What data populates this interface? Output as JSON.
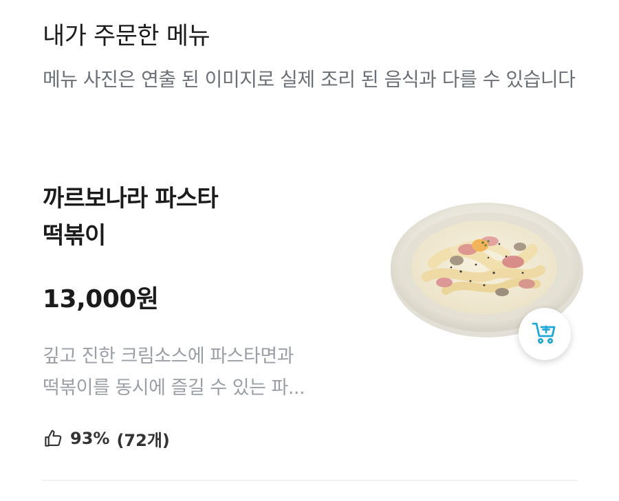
{
  "section": {
    "title": "내가 주문한 메뉴",
    "notice": "메뉴 사진은 연출 된 이미지로 실제 조리 된 음식과 다를 수 있습니다"
  },
  "menu_item": {
    "name_line1": "까르보나라 파스타",
    "name_line2": "떡볶이",
    "price": "13,000원",
    "description_line1": "깊고 진한 크림소스에 파스타면과",
    "description_line2": "떡볶이를 동시에 즐길 수 있는 파...",
    "rating_percent": "93%",
    "rating_count": "(72개)",
    "icons": {
      "thumbs_up": "thumbs-up-icon",
      "cart_add": "cart-add-icon"
    }
  },
  "colors": {
    "accent": "#1fa7d8",
    "title_text": "#1b1b1b",
    "notice_text": "#6b6f76",
    "description_text": "#9a9ea5"
  }
}
